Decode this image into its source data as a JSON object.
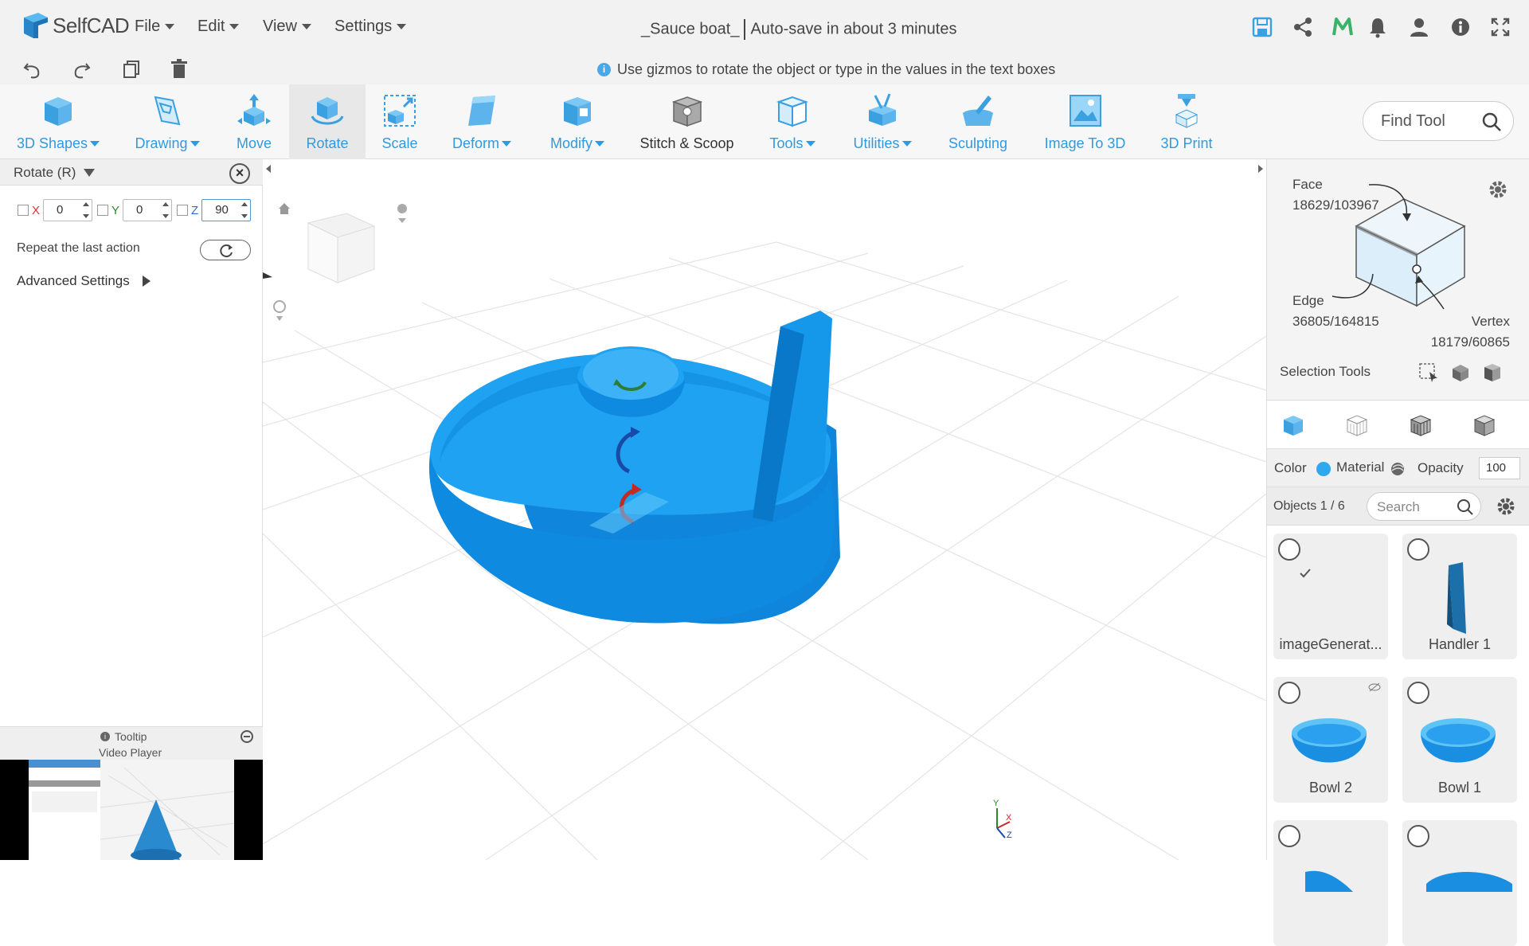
{
  "app": {
    "name": "SelfCAD"
  },
  "menu": {
    "file": "File",
    "edit": "Edit",
    "view": "View",
    "settings": "Settings"
  },
  "document": {
    "title": "_Sauce boat_",
    "autosave": "Auto-save in about 3 minutes"
  },
  "hint": "Use gizmos to rotate the object or type in the values in the text boxes",
  "toolbar": {
    "shapes": "3D Shapes",
    "drawing": "Drawing",
    "move": "Move",
    "rotate": "Rotate",
    "scale": "Scale",
    "deform": "Deform",
    "modify": "Modify",
    "stitch": "Stitch & Scoop",
    "tools": "Tools",
    "utilities": "Utilities",
    "sculpting": "Sculpting",
    "image_to_3d": "Image To 3D",
    "print": "3D Print",
    "find_tool": "Find Tool"
  },
  "rotate_panel": {
    "title": "Rotate (R)",
    "x_label": "X",
    "x_value": "0",
    "y_label": "Y",
    "y_value": "0",
    "z_label": "Z",
    "z_value": "90",
    "repeat_label": "Repeat the last action",
    "advanced": "Advanced Settings"
  },
  "tooltip": {
    "title": "Tooltip",
    "subtitle": "Video Player"
  },
  "selection": {
    "face_label": "Face",
    "face_value": "18629/103967",
    "edge_label": "Edge",
    "edge_value": "36805/164815",
    "vertex_label": "Vertex",
    "vertex_value": "18179/60865",
    "tools_label": "Selection Tools"
  },
  "properties": {
    "color_label": "Color",
    "color": "#2fa8f0",
    "material_label": "Material",
    "opacity_label": "Opacity",
    "opacity_value": "100"
  },
  "objects": {
    "label": "Objects 1 / 6",
    "search_placeholder": "Search",
    "items": [
      {
        "name": "imageGenerat...",
        "checked": true
      },
      {
        "name": "Handler 1",
        "checked": false
      },
      {
        "name": "Bowl 2",
        "checked": false,
        "hidden": true
      },
      {
        "name": "Bowl 1",
        "checked": false
      },
      {
        "name": "",
        "checked": false
      },
      {
        "name": "",
        "checked": false
      }
    ]
  },
  "colors": {
    "accent": "#2f9ae0",
    "model": "#1a9cf0"
  }
}
